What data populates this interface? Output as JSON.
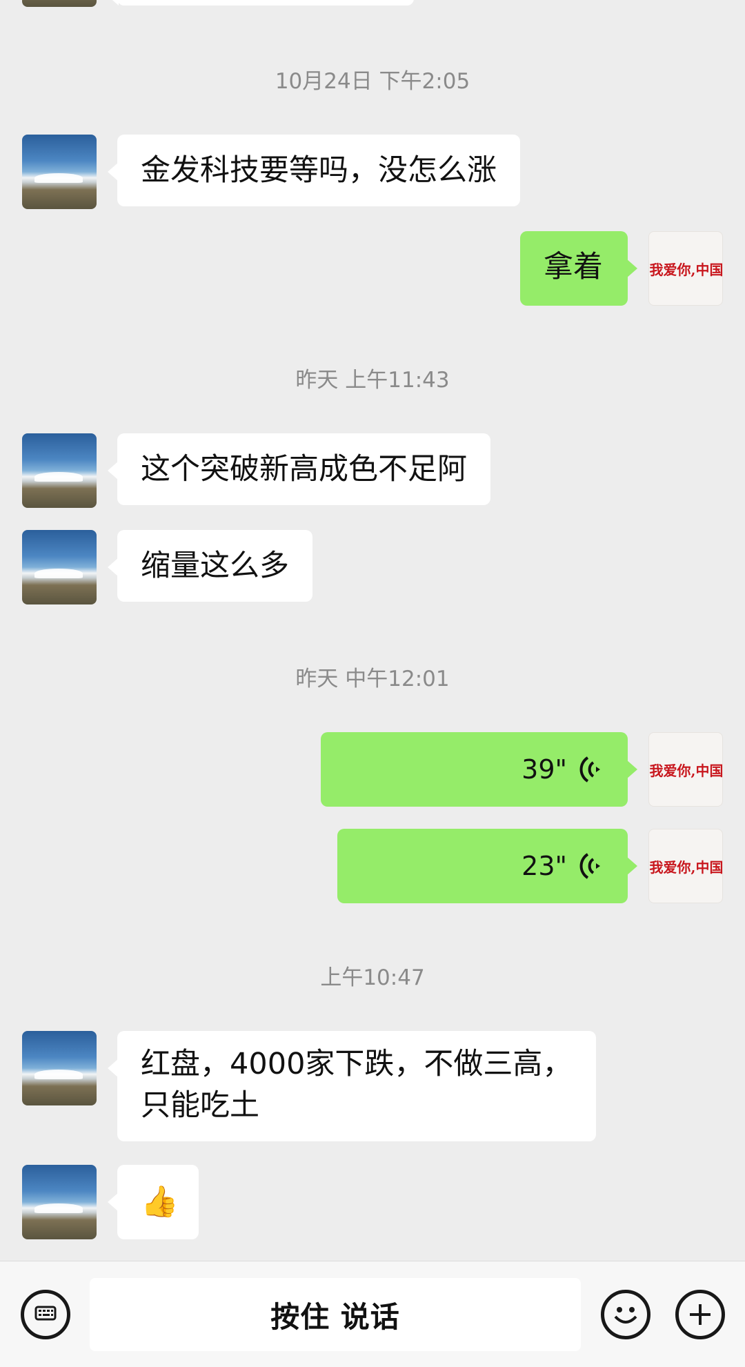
{
  "timestamps": [
    "10月24日 下午2:05",
    "昨天 上午11:43",
    "昨天 中午12:01",
    "上午10:47"
  ],
  "messages": {
    "m1": "金发科技要等吗，没怎么涨",
    "m2": "拿着",
    "m3": "这个突破新高成色不足阿",
    "m4": "缩量这么多",
    "m5_duration": "39\"",
    "m6_duration": "23\"",
    "m7_line1": "红盘，4000家下跌，不做三高，",
    "m7_line2": "只能吃土",
    "m8_emoji": "👍"
  },
  "contact_avatar_text": "我爱你,中国",
  "input_bar": {
    "hold_to_talk": "按住 说话"
  },
  "icons": {
    "keyboard": "keyboard-icon",
    "emoji": "emoji-icon",
    "plus": "plus-icon",
    "voice_wave": "voice-wave-icon"
  },
  "colors": {
    "background": "#ededed",
    "incoming_bubble": "#ffffff",
    "outgoing_bubble": "#95ec69",
    "timestamp_text": "#8a8a8a",
    "avatar_red_text": "#c8161d"
  }
}
